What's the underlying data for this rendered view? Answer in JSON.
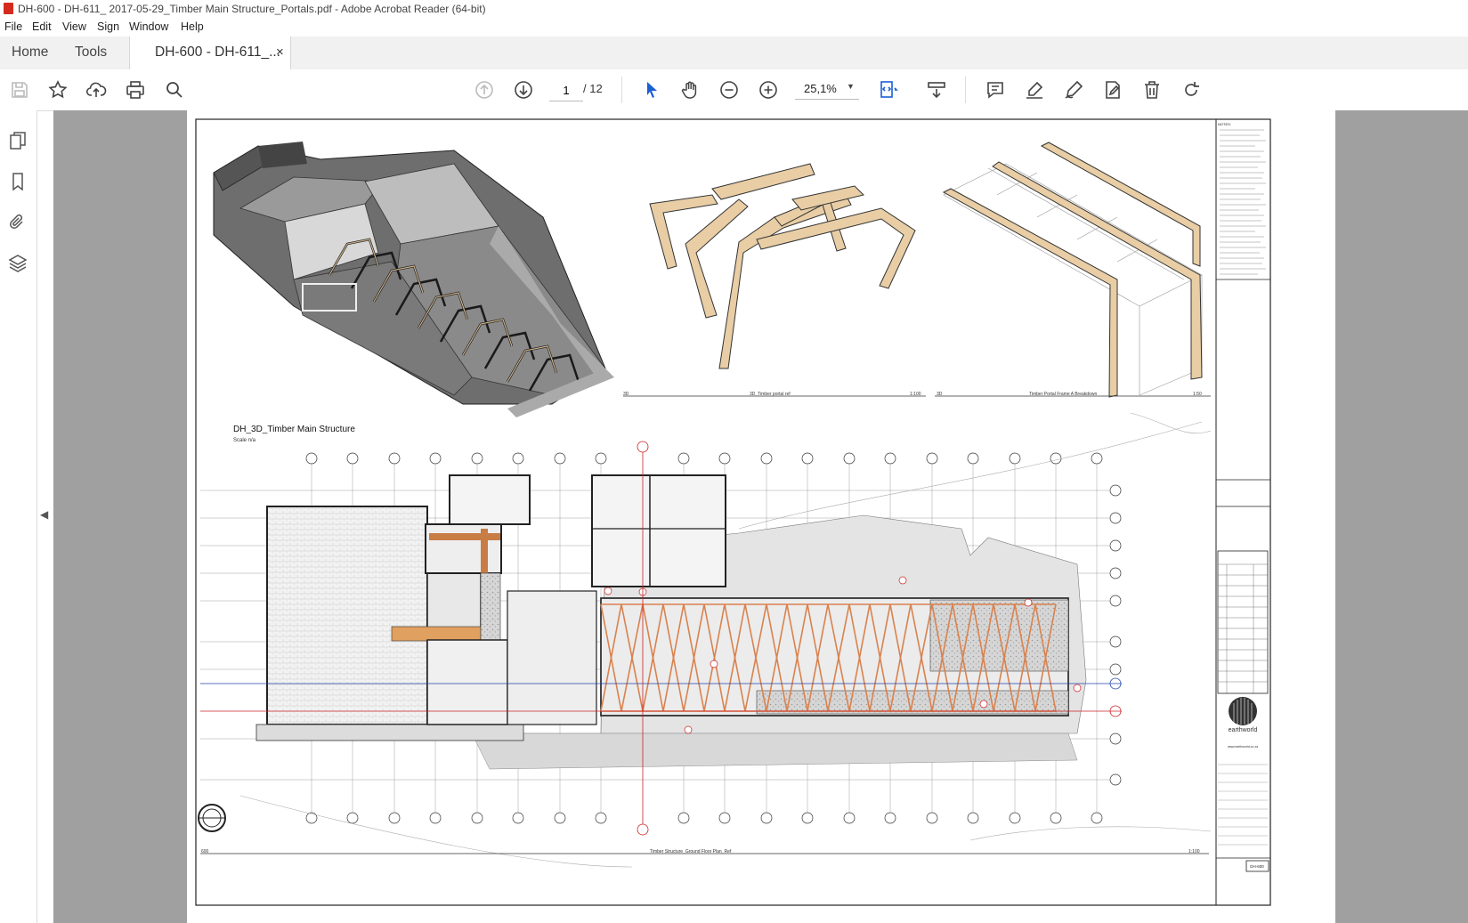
{
  "window": {
    "title": "DH-600 - DH-611_ 2017-05-29_Timber Main Structure_Portals.pdf - Adobe Acrobat Reader (64-bit)"
  },
  "menu": [
    "File",
    "Edit",
    "View",
    "Sign",
    "Window",
    "Help"
  ],
  "tabs": {
    "home": "Home",
    "tools": "Tools",
    "document": "DH-600 - DH-611_...",
    "close": "×"
  },
  "toolbar": {
    "current_page": "1",
    "page_total": "/ 12",
    "zoom": "25,1%",
    "icons": [
      "save-icon",
      "star-icon",
      "upload-icon",
      "print-icon",
      "search-icon",
      "page-up-icon",
      "page-down-icon",
      "select-arrow-icon",
      "hand-icon",
      "zoom-out-icon",
      "zoom-in-icon",
      "fit-page-icon",
      "scroll-mode-icon",
      "comment-icon",
      "highlight-icon",
      "sign-icon",
      "edit-pdf-icon",
      "delete-icon",
      "rotate-icon"
    ]
  },
  "sidebar": {
    "icons": [
      "pages-icon",
      "bookmark-icon",
      "attachment-icon",
      "layers-icon"
    ],
    "collapse": "◀"
  },
  "drawing": {
    "main_title": "DH_3D_Timber Main Structure",
    "main_scale": "Scale n/a",
    "view1_number": "3D",
    "view1_title": "3D_Timber portal ref",
    "view1_scale": "1:100",
    "view2_number": "3D",
    "view2_title": "Timber Portal Frame A Breakdown",
    "view2_scale": "1:50",
    "plan_number": "600",
    "plan_title": "Timber Structure_Ground Floor Plan_Ref",
    "plan_scale": "1:100",
    "notes_label": "NOTES:",
    "logo_text": "earthworld",
    "website": "www.earthworld.co.za",
    "sheet_number": "DH-600"
  },
  "colors": {
    "timber": "#e8cda5",
    "brace": "#d9824e",
    "gridline_red": "#cc2222",
    "gridline_blue": "#2244aa",
    "viewer_bg": "#a0a0a0"
  }
}
